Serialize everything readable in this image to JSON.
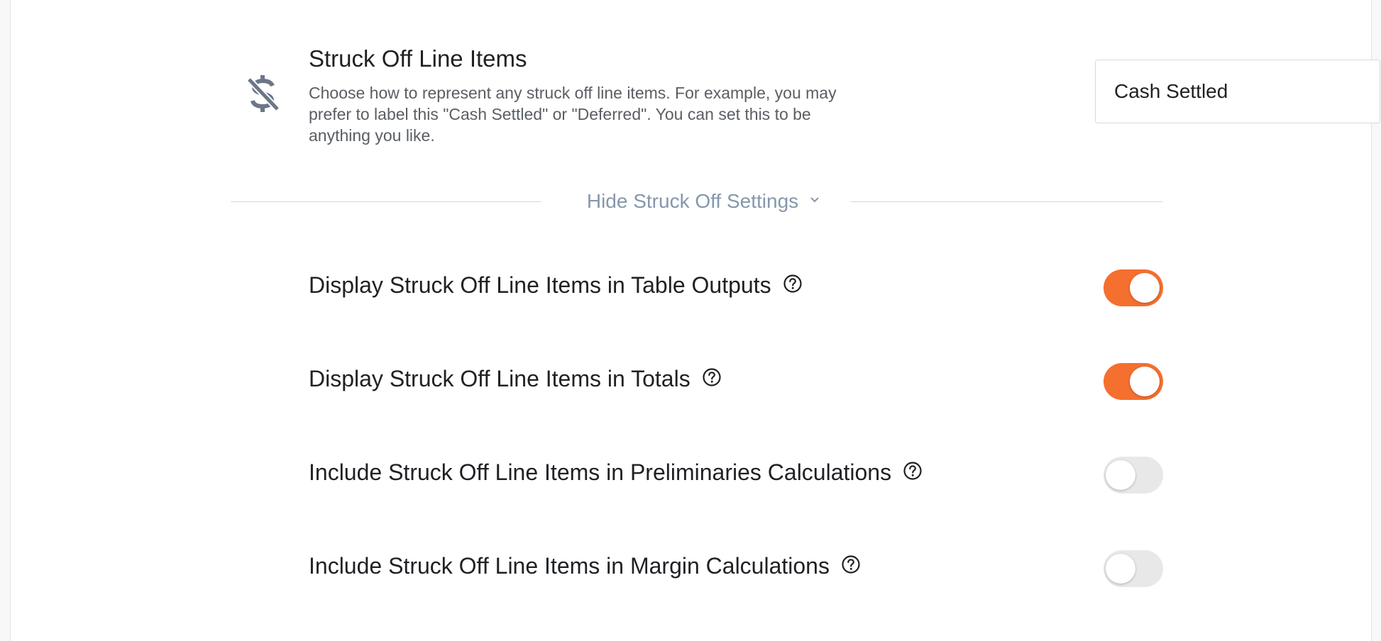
{
  "struck_off": {
    "title": "Struck Off Line Items",
    "description": "Choose how to represent any struck off line items. For example, you may prefer to label this \"Cash Settled\" or \"Deferred\". You can set this to be anything you like.",
    "label_value": "Cash Settled",
    "icon": "no-dollar-icon"
  },
  "settings_toggle": {
    "label": "Hide Struck Off Settings",
    "icon": "chevron-down-icon"
  },
  "toggles": [
    {
      "label": "Display Struck Off Line Items in Table Outputs",
      "on": true
    },
    {
      "label": "Display Struck Off Line Items in Totals",
      "on": true
    },
    {
      "label": "Include Struck Off Line Items in Preliminaries Calculations",
      "on": false
    },
    {
      "label": "Include Struck Off Line Items in Margin Calculations",
      "on": false
    }
  ],
  "colors": {
    "accent": "#f56f2f",
    "toggle_off": "#e8e8e9",
    "link_muted": "#8597ad",
    "icon": "#6b7688"
  }
}
